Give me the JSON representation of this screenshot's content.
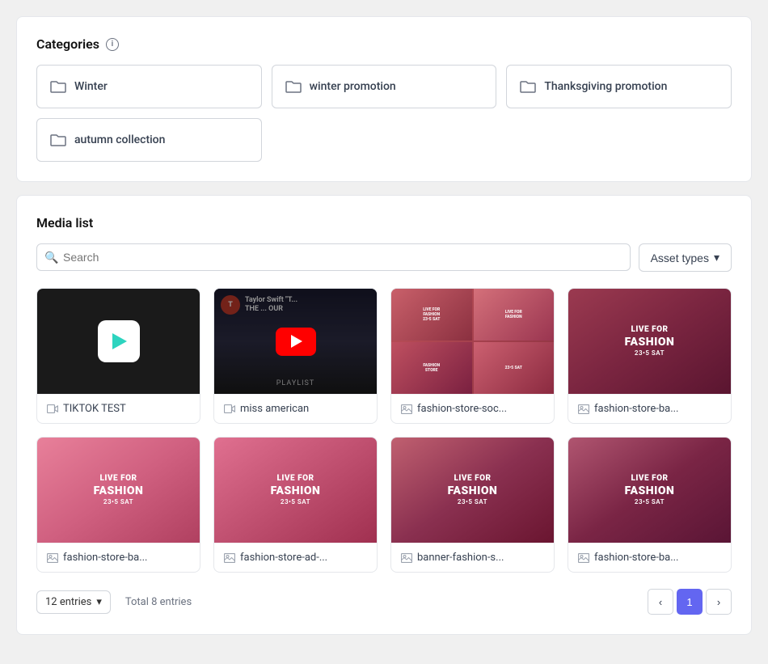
{
  "categories": {
    "title": "Categories",
    "info_icon": "i",
    "items": [
      {
        "label": "Winter",
        "id": "winter"
      },
      {
        "label": "winter promotion",
        "id": "winter-promotion"
      },
      {
        "label": "Thanksgiving promotion",
        "id": "thanksgiving-promotion"
      }
    ],
    "extra_items": [
      {
        "label": "autumn collection",
        "id": "autumn-collection"
      }
    ]
  },
  "media_list": {
    "title": "Media list",
    "search": {
      "placeholder": "Search",
      "value": ""
    },
    "asset_types_label": "Asset types",
    "items": [
      {
        "id": "tiktok-test",
        "label": "TIKTOK TEST",
        "type": "video",
        "thumb_type": "black-play"
      },
      {
        "id": "miss-american",
        "label": "miss american",
        "type": "video",
        "thumb_type": "youtube"
      },
      {
        "id": "fashion-store-soc",
        "label": "fashion-store-soc...",
        "type": "image",
        "thumb_type": "fashion-grid"
      },
      {
        "id": "fashion-store-ba-1",
        "label": "fashion-store-ba...",
        "type": "image",
        "thumb_type": "fashion-single"
      },
      {
        "id": "fashion-store-ba-2",
        "label": "fashion-store-ba...",
        "type": "image",
        "thumb_type": "fashion-pink"
      },
      {
        "id": "fashion-store-ad",
        "label": "fashion-store-ad-...",
        "type": "image",
        "thumb_type": "fashion-pink2"
      },
      {
        "id": "banner-fashion-s",
        "label": "banner-fashion-s...",
        "type": "image",
        "thumb_type": "fashion-dark"
      },
      {
        "id": "fashion-store-ba-3",
        "label": "fashion-store-ba...",
        "type": "image",
        "thumb_type": "fashion-dark2"
      }
    ],
    "pagination": {
      "entries_label": "12 entries",
      "total_label": "Total 8 entries",
      "current_page": 1,
      "pages": [
        1
      ]
    }
  }
}
